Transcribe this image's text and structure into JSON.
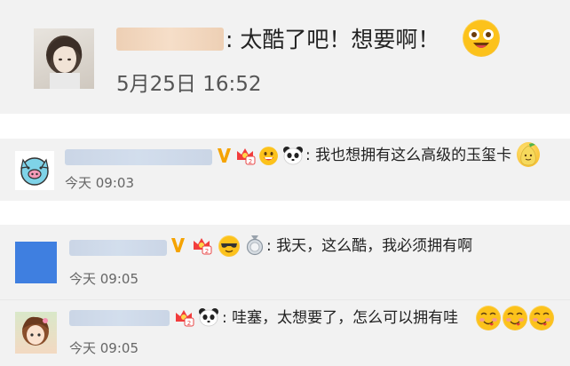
{
  "post": {
    "comment_text": ": 太酷了吧！想要啊！",
    "timestamp": "5月25日 16:52"
  },
  "comments": [
    {
      "text": ": 我也想拥有这么高级的玉玺卡",
      "timestamp": "今天 09:03"
    },
    {
      "text": ": 我天，这么酷，我必须拥有啊",
      "timestamp": "今天 09:05"
    },
    {
      "text": ": 哇塞，太想要了，怎么可以拥有哇",
      "timestamp": "今天 09:05"
    }
  ],
  "colors": {
    "card_background": "#f2f2f2",
    "verified_v": "#f5a300",
    "text": "#222222",
    "timestamp": "#666666"
  },
  "icons": [
    "excited-face-icon",
    "verified-v-icon",
    "vip-crown-badge",
    "grinning-face-icon",
    "panda-icon",
    "pear-face-icon",
    "cool-face-icon",
    "medal-icon",
    "yummy-face-icon"
  ]
}
